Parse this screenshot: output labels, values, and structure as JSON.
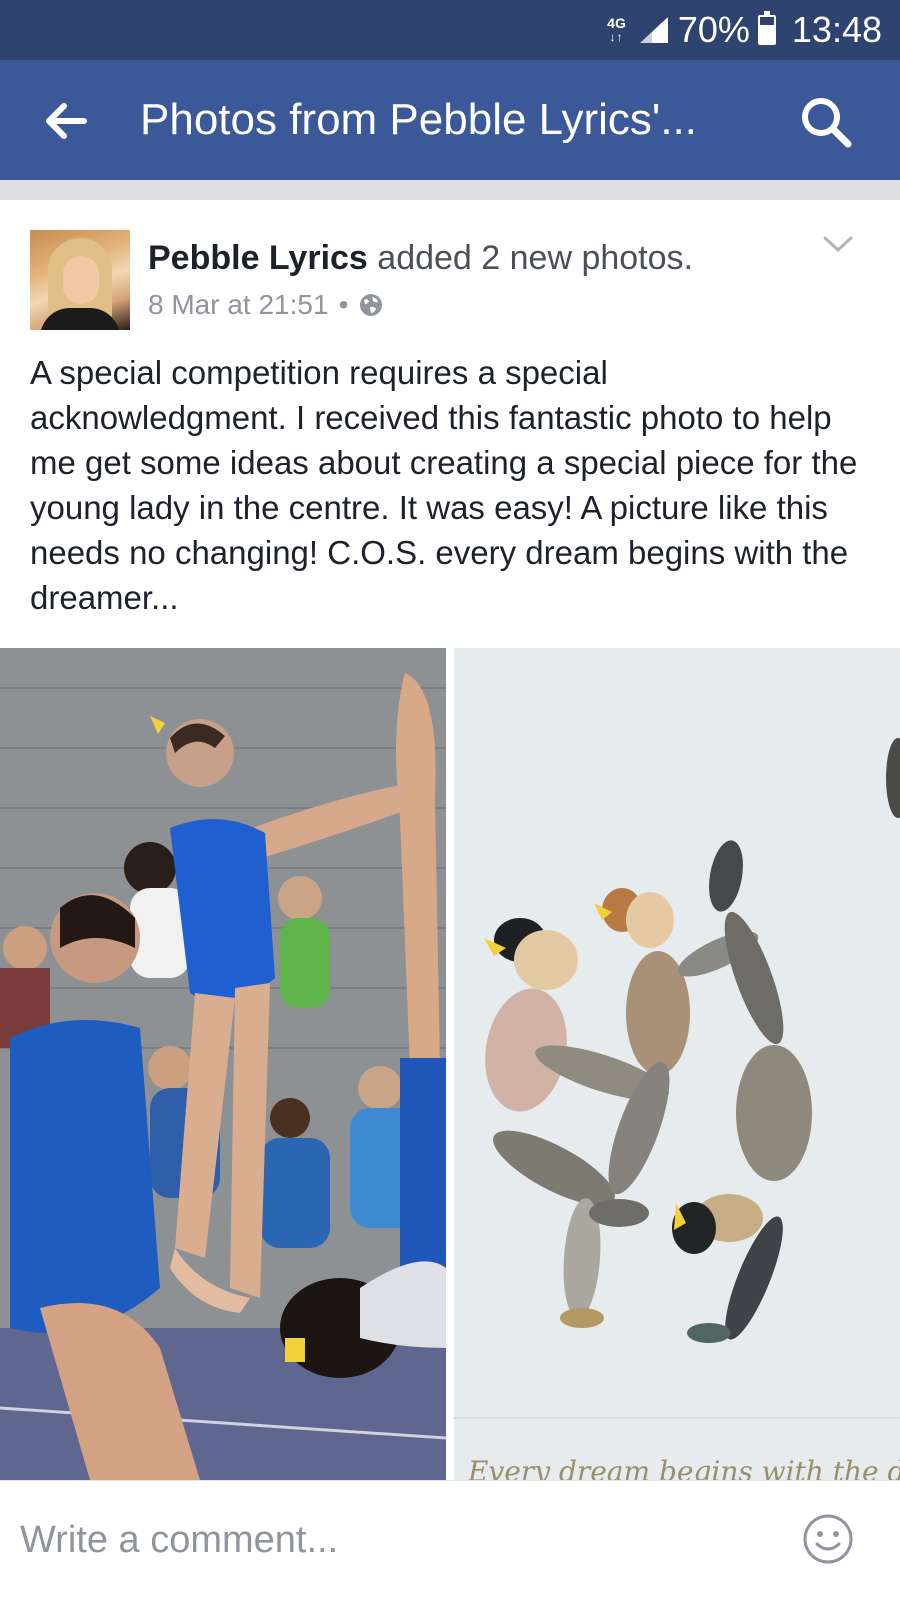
{
  "status_bar": {
    "network": "4G",
    "network_arrows": "↓↑",
    "battery_percent": "70%",
    "battery_level": 0.7,
    "time": "13:48"
  },
  "header": {
    "title": "Photos from Pebble Lyrics'...",
    "back_icon": "arrow-left-icon",
    "search_icon": "search-icon"
  },
  "post": {
    "author": "Pebble Lyrics",
    "action": " added 2 new photos.",
    "timestamp": "8 Mar at 21:51",
    "separator": "•",
    "privacy_icon": "globe-icon",
    "menu_icon": "chevron-down-icon",
    "text": "A special competition requires a special acknowledgment. I received this fantastic photo to help me get some ideas about creating a special piece for the young lady in the centre. It was easy! A picture like this needs no changing! C.O.S. every dream begins with the dreamer...",
    "photos": [
      {
        "name": "gymnasts-photo"
      },
      {
        "name": "pebble-art-photo",
        "caption": "Every dream begins with the d"
      }
    ]
  },
  "comment": {
    "placeholder": "Write a comment...",
    "emoji_icon": "smiley-icon"
  },
  "colors": {
    "status_bar": "#2f4370",
    "header": "#3b5998",
    "divider": "#dddfe2",
    "meta_text": "#90949c"
  }
}
